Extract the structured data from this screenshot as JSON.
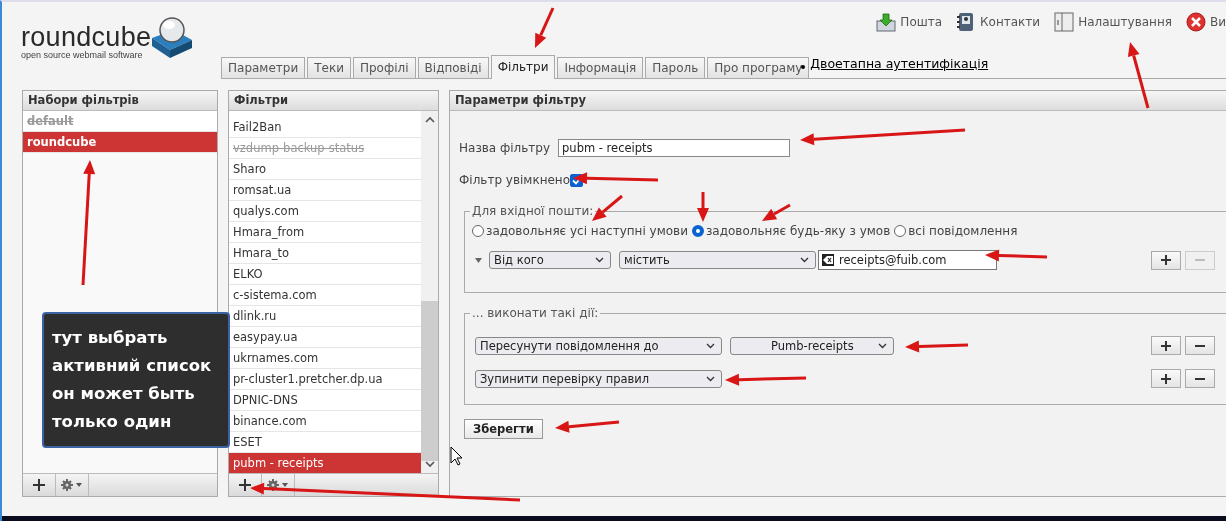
{
  "logo": {
    "name": "roundcube",
    "tagline": "open source webmail software"
  },
  "top_nav": [
    {
      "label": "Пошта",
      "kind": "mail"
    },
    {
      "label": "Контакти",
      "kind": "contacts"
    },
    {
      "label": "Налаштування",
      "kind": "settings"
    },
    {
      "label": "Ви",
      "kind": "logout"
    }
  ],
  "tabs": [
    {
      "label": "Параметри",
      "selected": false
    },
    {
      "label": "Теки",
      "selected": false
    },
    {
      "label": "Профілі",
      "selected": false
    },
    {
      "label": "Відповіді",
      "selected": false
    },
    {
      "label": "Фільтри",
      "selected": true
    },
    {
      "label": "Інформація",
      "selected": false
    },
    {
      "label": "Пароль",
      "selected": false
    },
    {
      "label": "Про програму",
      "selected": false
    }
  ],
  "extra_link": "Двоетапна аутентифікація",
  "filter_sets": {
    "title": "Набори фільтрів",
    "items": [
      {
        "label": "default",
        "disabled": true,
        "selected": false
      },
      {
        "label": "roundcube",
        "disabled": false,
        "selected": true
      }
    ]
  },
  "filters": {
    "title": "Фільтри",
    "items": [
      {
        "label": "Fail2Ban",
        "disabled": false,
        "selected": false
      },
      {
        "label": "vzdump-backup-status",
        "disabled": true,
        "selected": false
      },
      {
        "label": "Sharo",
        "disabled": false,
        "selected": false
      },
      {
        "label": "romsat.ua",
        "disabled": false,
        "selected": false
      },
      {
        "label": "qualys.com",
        "disabled": false,
        "selected": false
      },
      {
        "label": "Hmara_from",
        "disabled": false,
        "selected": false
      },
      {
        "label": "Hmara_to",
        "disabled": false,
        "selected": false
      },
      {
        "label": "ELKO",
        "disabled": false,
        "selected": false
      },
      {
        "label": "c-sistema.com",
        "disabled": false,
        "selected": false
      },
      {
        "label": "dlink.ru",
        "disabled": false,
        "selected": false
      },
      {
        "label": "easypay.ua",
        "disabled": false,
        "selected": false
      },
      {
        "label": "ukrnames.com",
        "disabled": false,
        "selected": false
      },
      {
        "label": "pr-cluster1.pretcher.dp.ua",
        "disabled": false,
        "selected": false
      },
      {
        "label": "DPNIC-DNS",
        "disabled": false,
        "selected": false
      },
      {
        "label": "binance.com",
        "disabled": false,
        "selected": false
      },
      {
        "label": "ESET",
        "disabled": false,
        "selected": false
      },
      {
        "label": "pubm - receipts",
        "disabled": false,
        "selected": true
      }
    ]
  },
  "filter_settings": {
    "title": "Параметри фільтру",
    "name_label": "Назва фільтру",
    "name_value": "pubm - receipts",
    "enabled_label": "Фільтр увімкнено",
    "enabled": true,
    "incoming_legend": "Для вхідної пошти:",
    "match_options": [
      {
        "label": "задовольняє усі наступні умови",
        "selected": false
      },
      {
        "label": "задовольняє будь-яку з умов",
        "selected": true
      },
      {
        "label": "всі повідомлення",
        "selected": false
      }
    ],
    "rules": [
      {
        "header": "Від кого",
        "operator": "містить",
        "value": "receipts@fuib.com",
        "remove_disabled": true
      }
    ],
    "actions_legend": "... виконати такі дії:",
    "actions": [
      {
        "action": "Пересунути повідомлення до",
        "target": "Pumb-receipts"
      },
      {
        "action": "Зупинити перевірку правил"
      }
    ],
    "save_button": "Зберегти"
  },
  "callout": "тут выбрать активний список он может быть только один"
}
